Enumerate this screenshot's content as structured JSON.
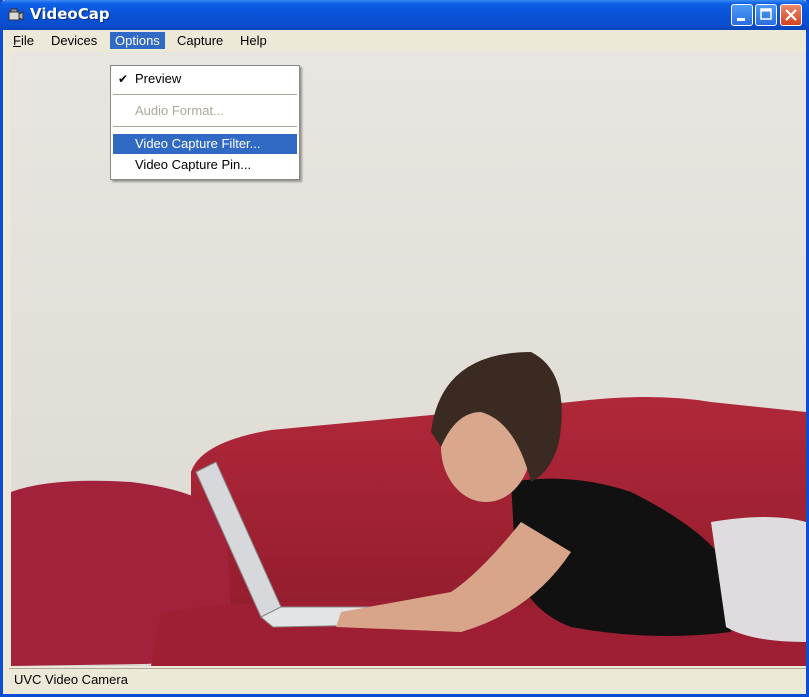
{
  "window": {
    "title": "VideoCap"
  },
  "menubar": {
    "items": [
      {
        "label": "File",
        "mnemonic": "F",
        "rest": "ile"
      },
      {
        "label": "Devices"
      },
      {
        "label": "Options"
      },
      {
        "label": "Capture"
      },
      {
        "label": "Help"
      }
    ]
  },
  "options_menu": {
    "items": [
      {
        "label": "Preview",
        "checked": true,
        "enabled": true
      },
      {
        "label": "Audio Format...",
        "enabled": false
      },
      {
        "label": "Video Capture Filter...",
        "enabled": true,
        "highlighted": true
      },
      {
        "label": "Video Capture Pin...",
        "enabled": true
      }
    ]
  },
  "status": {
    "text": "UVC Video Camera"
  },
  "icons": {
    "app": "camera-icon",
    "check": "checkmark-icon"
  }
}
